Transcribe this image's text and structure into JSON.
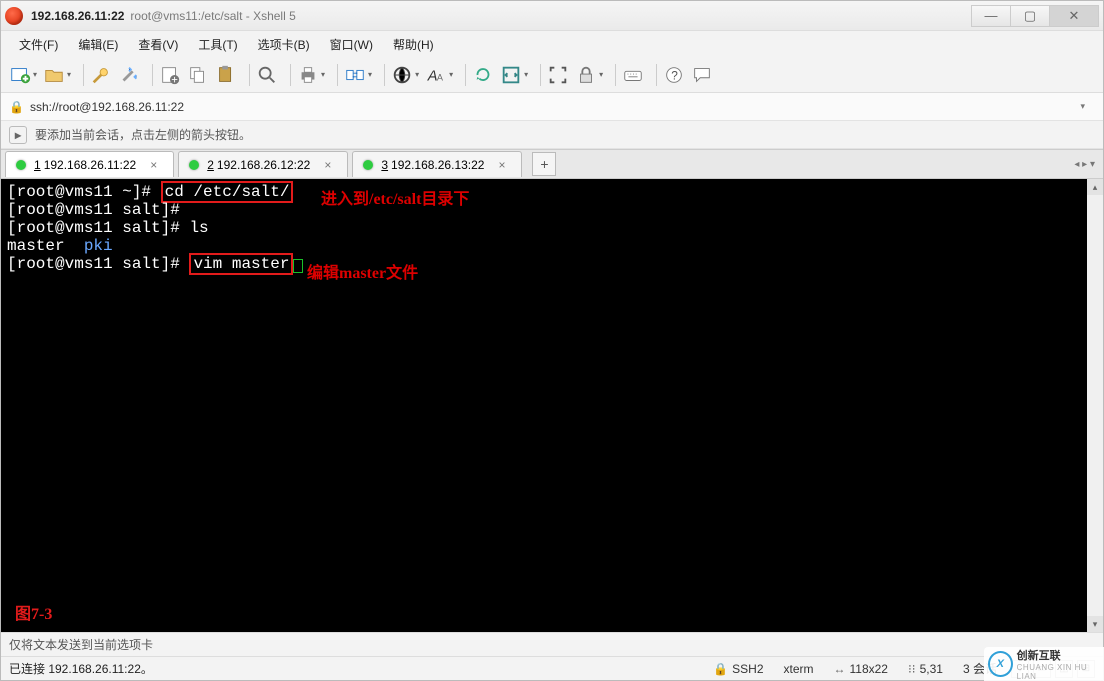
{
  "title": {
    "ip_bold": "192.168.26.11:22",
    "path": "root@vms11:/etc/salt - Xshell 5"
  },
  "menu": {
    "file": "文件(F)",
    "edit": "编辑(E)",
    "view": "查看(V)",
    "tools": "工具(T)",
    "tab": "选项卡(B)",
    "window": "窗口(W)",
    "help": "帮助(H)"
  },
  "address": "ssh://root@192.168.26.11:22",
  "hint": "要添加当前会话，点击左侧的箭头按钮。",
  "tabs": [
    {
      "num": "1",
      "label": "192.168.26.11:22",
      "active": true
    },
    {
      "num": "2",
      "label": "192.168.26.12:22",
      "active": false
    },
    {
      "num": "3",
      "label": "192.168.26.13:22",
      "active": false
    }
  ],
  "terminal": {
    "lines": [
      {
        "prompt": "[root@vms11 ~]# ",
        "cmd": "cd /etc/salt/",
        "boxed": true
      },
      {
        "prompt": "[root@vms11 salt]#",
        "cmd": "",
        "boxed": false
      },
      {
        "prompt": "[root@vms11 salt]# ",
        "cmd": "ls",
        "boxed": false
      },
      {
        "raw": "master  ",
        "blue": "pki"
      },
      {
        "prompt": "[root@vms11 salt]# ",
        "cmd": "vim master",
        "boxed": true,
        "cursor": true
      }
    ],
    "annot1": "进入到/etc/salt目录下",
    "annot2": "编辑master文件",
    "figure": "图7-3"
  },
  "footer": {
    "send": "仅将文本发送到当前选项卡"
  },
  "status": {
    "connected": "已连接 192.168.26.11:22。",
    "proto": "SSH2",
    "type": "xterm",
    "size": "118x22",
    "pos": "5,31",
    "sessions": "3 会话"
  },
  "watermark": {
    "brand": "创新互联",
    "sub": "CHUANG XIN HU LIAN"
  }
}
